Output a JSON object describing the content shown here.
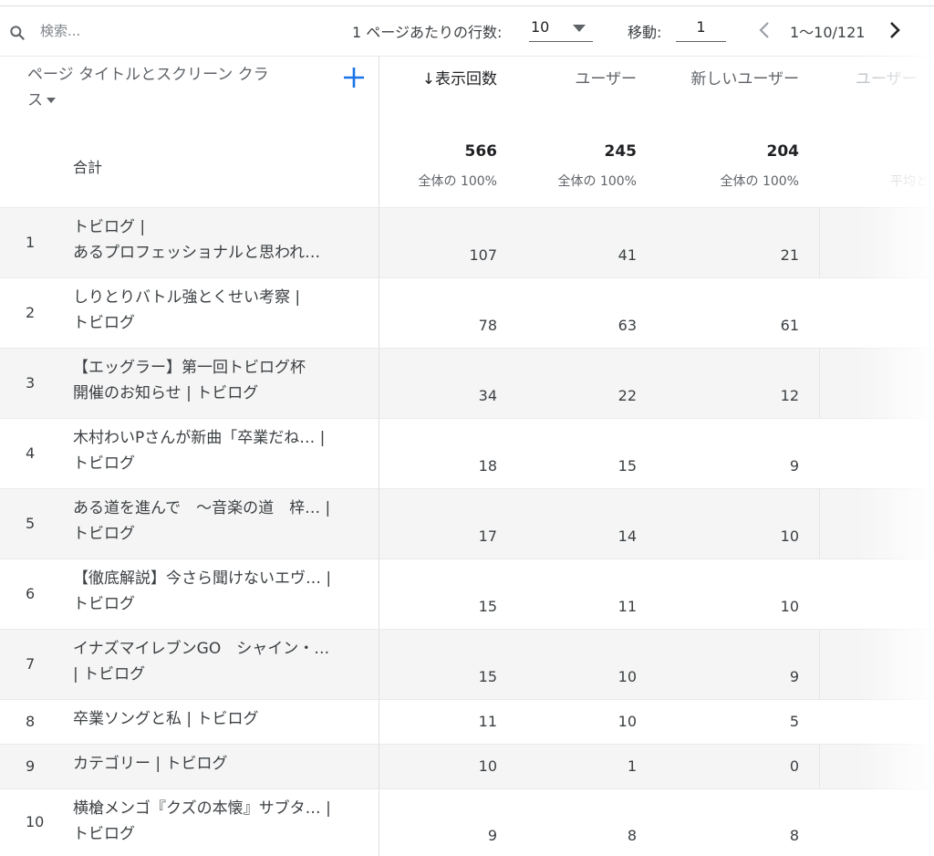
{
  "toolbar": {
    "search_placeholder": "検索...",
    "rows_per_page_label": "1 ページあたりの行数:",
    "rows_per_page_value": "10",
    "goto_label": "移動:",
    "goto_value": "1",
    "range": "1〜10/121"
  },
  "table": {
    "dimension_header": "ページ タイトルとスクリーン クラス",
    "columns": [
      {
        "label": "↓表示回数",
        "total": "566",
        "total_sub": "全体の 100%"
      },
      {
        "label": "ユーザー",
        "total": "245",
        "total_sub": "全体の 100%"
      },
      {
        "label": "新しいユーザー",
        "total": "204",
        "total_sub": "全体の 100%"
      },
      {
        "label": "ユーザー",
        "total": "",
        "total_sub": "平均と"
      }
    ],
    "total_label": "合計",
    "rows": [
      {
        "num": "1",
        "title_l1": "トビログ |",
        "title_l2": "あるプロフェッショナルと思われ…",
        "views": "107",
        "users": "41",
        "new_users": "21"
      },
      {
        "num": "2",
        "title_l1": "しりとりバトル強とくせい考察 |",
        "title_l2": "トビログ",
        "views": "78",
        "users": "63",
        "new_users": "61"
      },
      {
        "num": "3",
        "title_l1": "【エッグラー】第一回トビログ杯",
        "title_l2": "開催のお知らせ | トビログ",
        "views": "34",
        "users": "22",
        "new_users": "12"
      },
      {
        "num": "4",
        "title_l1": "木村わいPさんが新曲「卒業だね… |",
        "title_l2": "トビログ",
        "views": "18",
        "users": "15",
        "new_users": "9"
      },
      {
        "num": "5",
        "title_l1": "ある道を進んで　〜音楽の道　梓… |",
        "title_l2": "トビログ",
        "views": "17",
        "users": "14",
        "new_users": "10"
      },
      {
        "num": "6",
        "title_l1": "【徹底解説】今さら聞けないエヴ… |",
        "title_l2": "トビログ",
        "views": "15",
        "users": "11",
        "new_users": "10"
      },
      {
        "num": "7",
        "title_l1": "イナズマイレブンGO　シャイン・…",
        "title_l2": "| トビログ",
        "views": "15",
        "users": "10",
        "new_users": "9"
      },
      {
        "num": "8",
        "title_l1": "卒業ソングと私 | トビログ",
        "title_l2": "",
        "views": "11",
        "users": "10",
        "new_users": "5"
      },
      {
        "num": "9",
        "title_l1": "カテゴリー | トビログ",
        "title_l2": "",
        "views": "10",
        "users": "1",
        "new_users": "0"
      },
      {
        "num": "10",
        "title_l1": "横槍メンゴ『クズの本懐』サブタ… |",
        "title_l2": "トビログ",
        "views": "9",
        "users": "8",
        "new_users": "8"
      }
    ]
  },
  "icons": {
    "search": "search-icon",
    "dropdown": "caret-down-icon",
    "prev": "chevron-left-icon",
    "next": "chevron-right-icon",
    "add": "plus-icon"
  },
  "colors": {
    "accent": "#1a73e8",
    "row_alt": "#f5f5f5"
  }
}
